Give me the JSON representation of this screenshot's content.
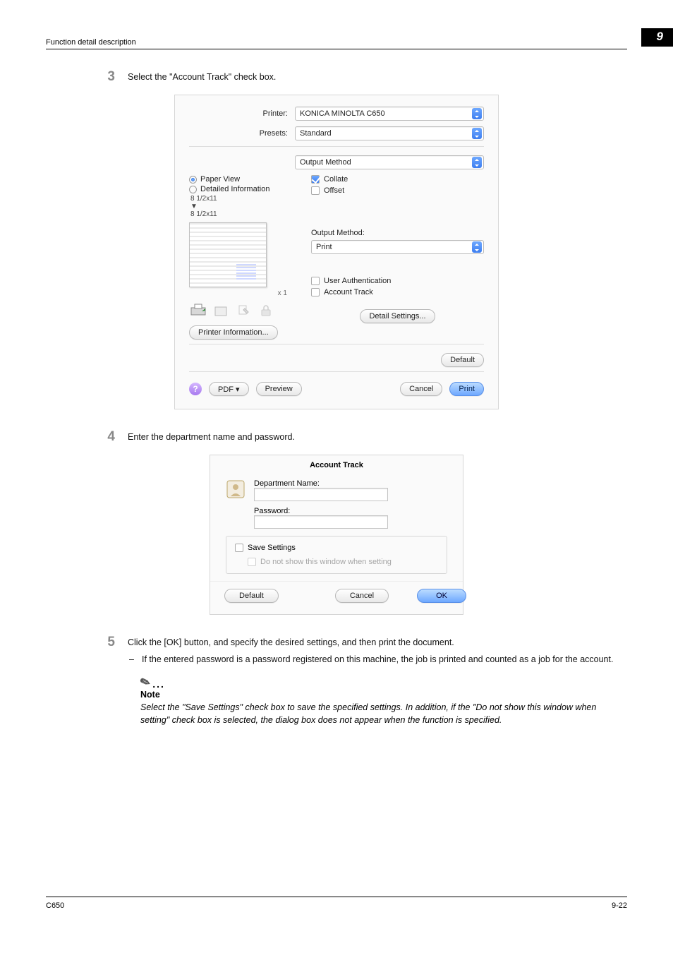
{
  "header": {
    "title": "Function detail description",
    "chapter": "9"
  },
  "steps": {
    "s3": "Select the \"Account Track\" check box.",
    "s4": "Enter the department name and password.",
    "s5": "Click the [OK] button, and specify the desired settings, and then print the document.",
    "s5_sub": "If the entered password is a password registered on this machine, the job is printed and counted as a job for the account."
  },
  "dialog1": {
    "printer_label": "Printer:",
    "printer_value": "KONICA MINOLTA C650",
    "presets_label": "Presets:",
    "presets_value": "Standard",
    "third_select": "Output Method",
    "radio_paper": "Paper View",
    "radio_detail": "Detailed Information",
    "paper_top": "8 1/2x11",
    "paper_arrow": "▼",
    "paper_bot": "8 1/2x11",
    "collate": "Collate",
    "offset": "Offset",
    "out_method_label": "Output Method:",
    "out_method_value": "Print",
    "x1": "x 1",
    "user_auth": "User Authentication",
    "acct_track": "Account Track",
    "printer_info_btn": "Printer Information...",
    "detail_settings_btn": "Detail Settings...",
    "default_btn": "Default",
    "pdf_btn": "PDF ▾",
    "preview_btn": "Preview",
    "cancel_btn": "Cancel",
    "print_btn": "Print"
  },
  "dialog2": {
    "title": "Account Track",
    "dept_label": "Department Name:",
    "pass_label": "Password:",
    "save_settings": "Save Settings",
    "do_not_show": "Do not show this window when setting",
    "default_btn": "Default",
    "cancel_btn": "Cancel",
    "ok_btn": "OK"
  },
  "note": {
    "heading": "Note",
    "body": "Select the \"Save Settings\" check box to save the specified settings. In addition, if the \"Do not show this window when setting\" check box is selected, the dialog box does not appear when the function is specified."
  },
  "footer": {
    "left": "C650",
    "right": "9-22"
  }
}
